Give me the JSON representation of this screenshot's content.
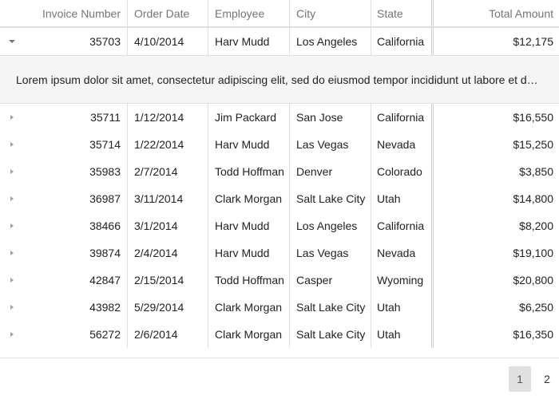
{
  "columns": {
    "invoice": "Invoice Number",
    "date": "Order Date",
    "employee": "Employee",
    "city": "City",
    "state": "State",
    "total": "Total Amount"
  },
  "rows": [
    {
      "invoice": "35703",
      "date": "4/10/2014",
      "employee": "Harv Mudd",
      "city": "Los Angeles",
      "state": "California",
      "total": "$12,175",
      "expanded": true
    },
    {
      "invoice": "35711",
      "date": "1/12/2014",
      "employee": "Jim Packard",
      "city": "San Jose",
      "state": "California",
      "total": "$16,550"
    },
    {
      "invoice": "35714",
      "date": "1/22/2014",
      "employee": "Harv Mudd",
      "city": "Las Vegas",
      "state": "Nevada",
      "total": "$15,250"
    },
    {
      "invoice": "35983",
      "date": "2/7/2014",
      "employee": "Todd Hoffman",
      "city": "Denver",
      "state": "Colorado",
      "total": "$3,850"
    },
    {
      "invoice": "36987",
      "date": "3/11/2014",
      "employee": "Clark Morgan",
      "city": "Salt Lake City",
      "state": "Utah",
      "total": "$14,800"
    },
    {
      "invoice": "38466",
      "date": "3/1/2014",
      "employee": "Harv Mudd",
      "city": "Los Angeles",
      "state": "California",
      "total": "$8,200"
    },
    {
      "invoice": "39874",
      "date": "2/4/2014",
      "employee": "Harv Mudd",
      "city": "Las Vegas",
      "state": "Nevada",
      "total": "$19,100"
    },
    {
      "invoice": "42847",
      "date": "2/15/2014",
      "employee": "Todd Hoffman",
      "city": "Casper",
      "state": "Wyoming",
      "total": "$20,800"
    },
    {
      "invoice": "43982",
      "date": "5/29/2014",
      "employee": "Clark Morgan",
      "city": "Salt Lake City",
      "state": "Utah",
      "total": "$6,250"
    },
    {
      "invoice": "56272",
      "date": "2/6/2014",
      "employee": "Clark Morgan",
      "city": "Salt Lake City",
      "state": "Utah",
      "total": "$16,350"
    }
  ],
  "detail_text": "Lorem ipsum dolor sit amet, consectetur adipiscing elit, sed do eiusmod tempor incididunt ut labore et dolore magna aliqua.",
  "pager": {
    "pages": [
      "1",
      "2"
    ],
    "current": "1"
  }
}
